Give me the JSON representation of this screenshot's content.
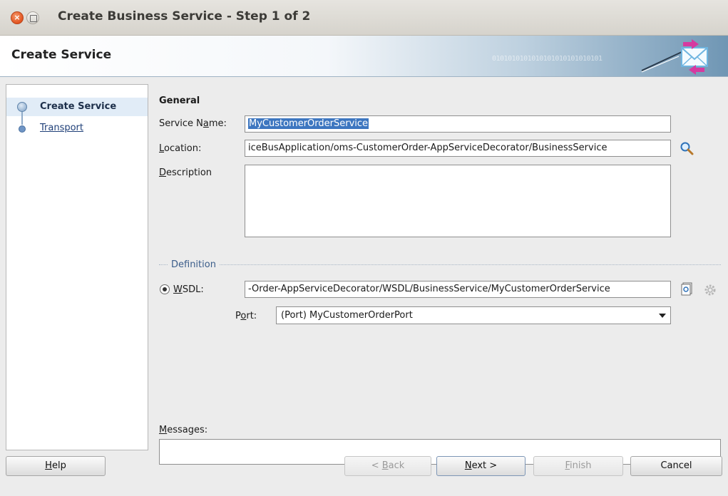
{
  "window": {
    "title": "Create Business Service - Step 1 of 2",
    "close_glyph": "×"
  },
  "banner": {
    "title": "Create Service",
    "binary_text": "0101010101010101010101010101",
    "icon": "send-message-icon"
  },
  "nav": {
    "items": [
      {
        "label": "Create Service",
        "active": true
      },
      {
        "label": "Transport",
        "active": false
      }
    ]
  },
  "form": {
    "section_title": "General",
    "service_name": {
      "label_pre": "Service N",
      "label_mn": "a",
      "label_post": "me:",
      "value": "MyCustomerOrderService"
    },
    "location": {
      "label_mn": "L",
      "label_post": "ocation:",
      "value": "iceBusApplication/oms-CustomerOrder-AppServiceDecorator/BusinessService"
    },
    "description": {
      "label_mn": "D",
      "label_post": "escription",
      "value": ""
    },
    "definition_legend": "Definition",
    "wsdl": {
      "label_mn": "W",
      "label_post": "SDL:",
      "value": "-Order-AppServiceDecorator/WSDL/BusinessService/MyCustomerOrderService",
      "selected": true
    },
    "port": {
      "label_pre": "P",
      "label_mn": "o",
      "label_post": "rt:",
      "value": "(Port) MyCustomerOrderPort"
    },
    "messages": {
      "label_mn": "M",
      "label_post": "essages:",
      "value": ""
    }
  },
  "buttons": {
    "help": {
      "mn": "H",
      "rest": "elp"
    },
    "back": {
      "pre": "< ",
      "mn": "B",
      "rest": "ack",
      "enabled": false
    },
    "next": {
      "mn": "N",
      "rest": "ext >",
      "enabled": true
    },
    "finish": {
      "mn": "F",
      "rest": "inish",
      "enabled": false
    },
    "cancel": {
      "label": "Cancel"
    }
  },
  "colors": {
    "selection": "#3d76c0",
    "legend": "#3b5d8a",
    "nav_active_bg": "#e1ecf7"
  }
}
